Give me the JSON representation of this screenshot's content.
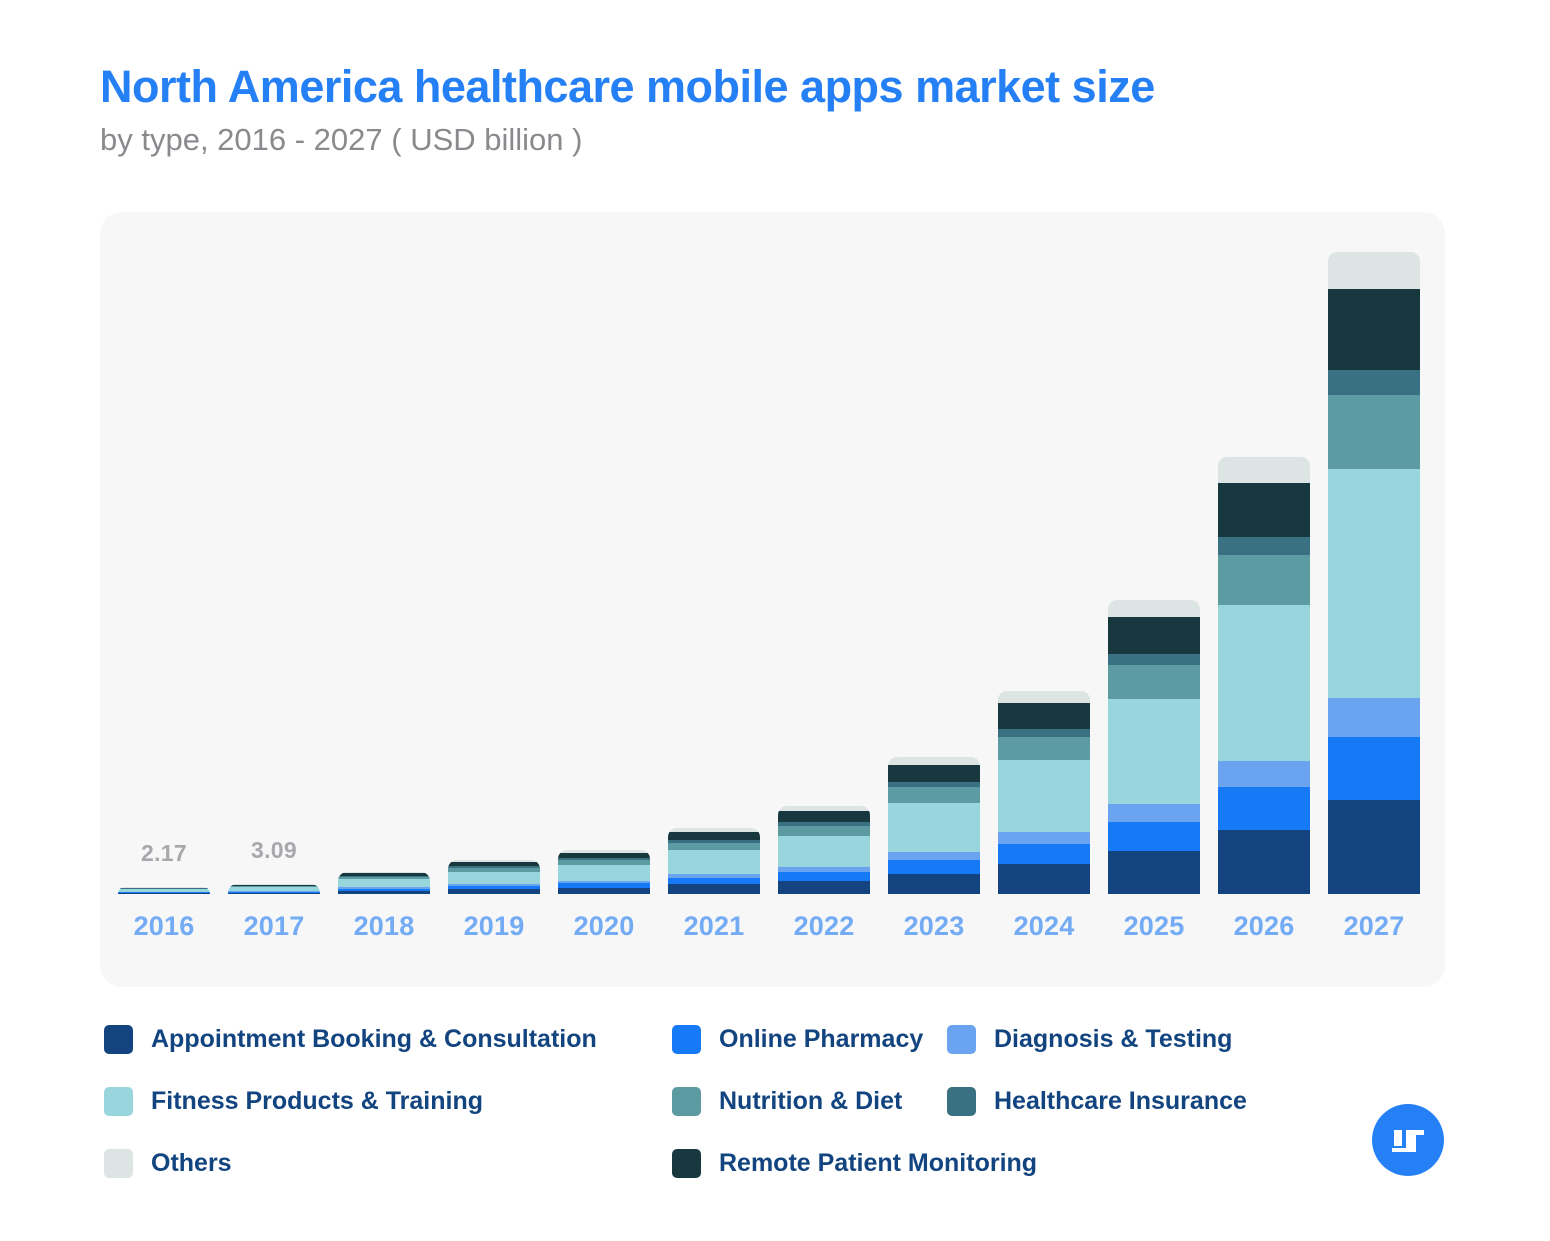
{
  "header": {
    "title": "North America healthcare mobile apps market size",
    "subtitle": "by type, 2016 - 2027 ( USD billion )",
    "title_color": "#2680f5",
    "subtitle_color": "#8a8a8e"
  },
  "legend": {
    "rows": [
      [
        {
          "label": "Appointment Booking & Consultation",
          "color": "#13447f"
        },
        {
          "label": "Online Pharmacy",
          "color": "#1679f5"
        },
        {
          "label": "Diagnosis & Testing",
          "color": "#6aa3ef"
        }
      ],
      [
        {
          "label": "Fitness Products & Training",
          "color": "#99d5dd"
        },
        {
          "label": "Nutrition & Diet",
          "color": "#5d9ba2"
        },
        {
          "label": "Healthcare Insurance",
          "color": "#3a7182"
        }
      ],
      [
        {
          "label": "Others",
          "color": "#dde5e4"
        },
        {
          "label": "Remote Patient Monitoring",
          "color": "#183840"
        }
      ]
    ],
    "text_color": "#12447f"
  },
  "logo": {
    "name": "brand-logo",
    "background": "#2680f5",
    "mark_color": "#ffffff"
  },
  "chart_data": {
    "type": "bar",
    "subtype": "stacked",
    "title": "North America healthcare mobile apps market size",
    "subtitle": "by type, 2016 - 2027 ( USD billion )",
    "xlabel": "",
    "ylabel": "USD billion",
    "grid": false,
    "legend_position": "bottom",
    "axis_label_color": "#73abf5",
    "value_label_color": "#a8a8ac",
    "panel_background": "#f7f7f8",
    "ylim": [
      0,
      200
    ],
    "categories": [
      "2016",
      "2017",
      "2018",
      "2019",
      "2020",
      "2021",
      "2022",
      "2023",
      "2024",
      "2025",
      "2026",
      "2027"
    ],
    "totals": [
      2.17,
      3.09,
      6.85,
      10.6,
      13.7,
      20.6,
      27.4,
      42.7,
      63.0,
      91.5,
      135.8,
      199.6
    ],
    "value_labels": [
      {
        "category": "2016",
        "text": "2.17"
      },
      {
        "category": "2017",
        "text": "3.09"
      }
    ],
    "series": [
      {
        "name": "Appointment Booking & Consultation",
        "color": "#13447f",
        "values": [
          0.31,
          0.45,
          1.0,
          1.54,
          2.0,
          3.01,
          4.0,
          6.23,
          9.19,
          13.35,
          19.81,
          29.12
        ]
      },
      {
        "name": "Online Pharmacy",
        "color": "#1679f5",
        "values": [
          0.21,
          0.31,
          0.68,
          1.05,
          1.36,
          2.04,
          2.72,
          4.24,
          6.25,
          9.08,
          13.48,
          19.8
        ]
      },
      {
        "name": "Diagnosis & Testing",
        "color": "#6aa3ef",
        "values": [
          0.13,
          0.19,
          0.41,
          0.64,
          0.82,
          1.24,
          1.65,
          2.57,
          3.79,
          5.51,
          8.17,
          12.01
        ]
      },
      {
        "name": "Fitness Products & Training",
        "color": "#99d5dd",
        "values": [
          0.77,
          1.1,
          2.44,
          3.77,
          4.88,
          7.34,
          9.76,
          15.21,
          22.44,
          32.59,
          48.37,
          71.1
        ]
      },
      {
        "name": "Nutrition & Diet",
        "color": "#5d9ba2",
        "values": [
          0.25,
          0.36,
          0.79,
          1.22,
          1.58,
          2.38,
          3.16,
          4.93,
          7.27,
          10.56,
          15.67,
          23.03
        ]
      },
      {
        "name": "Healthcare Insurance",
        "color": "#3a7182",
        "values": [
          0.09,
          0.12,
          0.27,
          0.42,
          0.55,
          0.82,
          1.09,
          1.7,
          2.51,
          3.64,
          5.41,
          7.95
        ]
      },
      {
        "name": "Remote Patient Monitoring",
        "color": "#183840",
        "values": [
          0.27,
          0.39,
          0.86,
          1.33,
          1.72,
          2.59,
          3.44,
          5.36,
          7.91,
          11.49,
          17.05,
          25.06
        ]
      },
      {
        "name": "Others",
        "color": "#dde5e4",
        "values": [
          0.14,
          0.17,
          0.4,
          0.63,
          0.79,
          1.18,
          1.58,
          2.46,
          3.64,
          5.28,
          7.84,
          11.53
        ]
      }
    ]
  }
}
